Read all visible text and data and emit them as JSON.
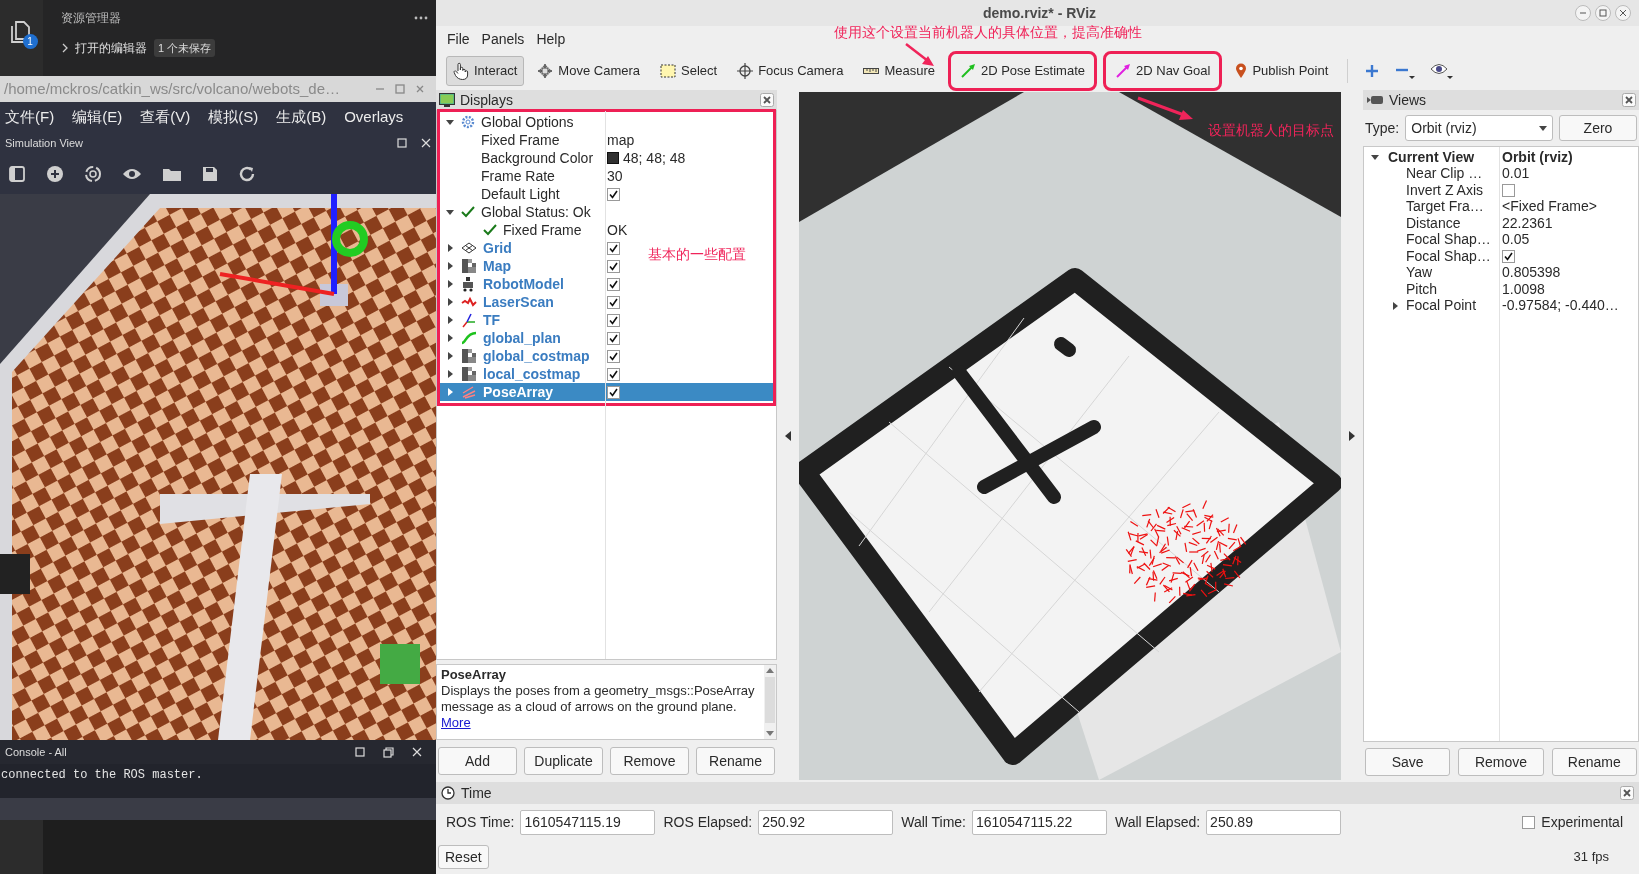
{
  "vscode": {
    "explorer_title": "资源管理器",
    "notification_badge": "1",
    "open_editors": "打开的编辑器",
    "unsaved_badge": "1 个未保存"
  },
  "webots": {
    "title": "/home/mckros/catkin_ws/src/volcano/webots_de…",
    "menu": [
      "文件(F)",
      "编辑(E)",
      "查看(V)",
      "模拟(S)",
      "生成(B)",
      "Overlays"
    ],
    "dock_title": "Simulation View",
    "console": {
      "title": "Console - All",
      "lines": [
        "connected to the ROS master."
      ]
    }
  },
  "rviz": {
    "title": "demo.rviz* - RViz",
    "menu": [
      "File",
      "Panels",
      "Help"
    ],
    "tools": [
      {
        "kind": "interact",
        "label": "Interact",
        "selected": true,
        "highlighted": false
      },
      {
        "kind": "move_camera",
        "label": "Move Camera",
        "selected": false,
        "highlighted": false
      },
      {
        "kind": "select",
        "label": "Select",
        "selected": false,
        "highlighted": false
      },
      {
        "kind": "focus_camera",
        "label": "Focus Camera",
        "selected": false,
        "highlighted": false
      },
      {
        "kind": "measure",
        "label": "Measure",
        "selected": false,
        "highlighted": false
      },
      {
        "kind": "pose_estimate",
        "label": "2D Pose Estimate",
        "selected": false,
        "highlighted": true
      },
      {
        "kind": "nav_goal",
        "label": "2D Nav Goal",
        "selected": false,
        "highlighted": true
      },
      {
        "kind": "publish_point",
        "label": "Publish Point",
        "selected": false,
        "highlighted": false
      }
    ],
    "displays": {
      "title": "Displays",
      "highlighted": true,
      "options": [
        {
          "kind": "group",
          "label": "Global Options",
          "expanded": true,
          "children": [
            {
              "kind": "text",
              "label": "Fixed Frame",
              "value": "map"
            },
            {
              "kind": "color",
              "label": "Background Color",
              "value": "48; 48; 48"
            },
            {
              "kind": "text",
              "label": "Frame Rate",
              "value": "30"
            },
            {
              "kind": "checkbox",
              "label": "Default Light",
              "checked": true
            }
          ]
        },
        {
          "kind": "status",
          "label": "Global Status: Ok",
          "expanded": true,
          "children": [
            {
              "kind": "status",
              "label": "Fixed Frame",
              "value": "OK"
            }
          ]
        }
      ],
      "items": [
        {
          "kind": "grid",
          "label": "Grid",
          "expanded": false,
          "checked": true,
          "selected": false
        },
        {
          "kind": "map",
          "label": "Map",
          "expanded": false,
          "checked": true,
          "selected": false
        },
        {
          "kind": "robot",
          "label": "RobotModel",
          "expanded": false,
          "checked": true,
          "selected": false
        },
        {
          "kind": "laser",
          "label": "LaserScan",
          "expanded": false,
          "checked": true,
          "selected": false
        },
        {
          "kind": "tf",
          "label": "TF",
          "expanded": false,
          "checked": true,
          "selected": false
        },
        {
          "kind": "path",
          "label": "global_plan",
          "expanded": false,
          "checked": true,
          "selected": false
        },
        {
          "kind": "map",
          "label": "global_costmap",
          "expanded": false,
          "checked": true,
          "selected": false
        },
        {
          "kind": "map",
          "label": "local_costmap",
          "expanded": false,
          "checked": true,
          "selected": false
        },
        {
          "kind": "pose_array",
          "label": "PoseArray",
          "expanded": false,
          "checked": true,
          "selected": true
        }
      ],
      "description": {
        "title": "PoseArray",
        "text": "Displays the poses from a geometry_msgs::PoseArray message as a cloud of arrows on the ground plane.",
        "link": "More"
      },
      "buttons": [
        "Add",
        "Duplicate",
        "Remove",
        "Rename"
      ]
    },
    "views": {
      "title": "Views",
      "type_label": "Type:",
      "type_value": "Orbit (rviz)",
      "zero_button": "Zero",
      "current": {
        "label": "Current View",
        "value": "Orbit (rviz)",
        "expanded": true,
        "children": [
          {
            "kind": "text",
            "label": "Near Clip …",
            "value": "0.01"
          },
          {
            "kind": "checkbox",
            "label": "Invert Z Axis",
            "checked": false
          },
          {
            "kind": "text",
            "label": "Target Fra…",
            "value": "<Fixed Frame>"
          },
          {
            "kind": "text",
            "label": "Distance",
            "value": "22.2361"
          },
          {
            "kind": "text",
            "label": "Focal Shap…",
            "value": "0.05"
          },
          {
            "kind": "checkbox",
            "label": "Focal Shap…",
            "checked": true
          },
          {
            "kind": "text",
            "label": "Yaw",
            "value": "0.805398"
          },
          {
            "kind": "text",
            "label": "Pitch",
            "value": "1.0098"
          },
          {
            "kind": "group",
            "label": "Focal Point",
            "value": "-0.97584; -0.440…",
            "expanded": false
          }
        ]
      },
      "buttons": [
        "Save",
        "Remove",
        "Rename"
      ]
    },
    "time": {
      "title": "Time",
      "fields": [
        {
          "label": "ROS Time:",
          "value": "1610547115.19"
        },
        {
          "label": "ROS Elapsed:",
          "value": "250.92"
        },
        {
          "label": "Wall Time:",
          "value": "1610547115.22"
        },
        {
          "label": "Wall Elapsed:",
          "value": "250.89"
        }
      ],
      "experimental": {
        "label": "Experimental",
        "checked": false
      },
      "reset_button": "Reset",
      "fps": "31 fps"
    }
  },
  "annotations": [
    {
      "kind": "pose_note",
      "text": "使用这个设置当前机器人的具体位置，提高准确性"
    },
    {
      "kind": "goal_note",
      "text": "设置机器人的目标点"
    },
    {
      "kind": "config_note",
      "text": "基本的一些配置"
    }
  ]
}
